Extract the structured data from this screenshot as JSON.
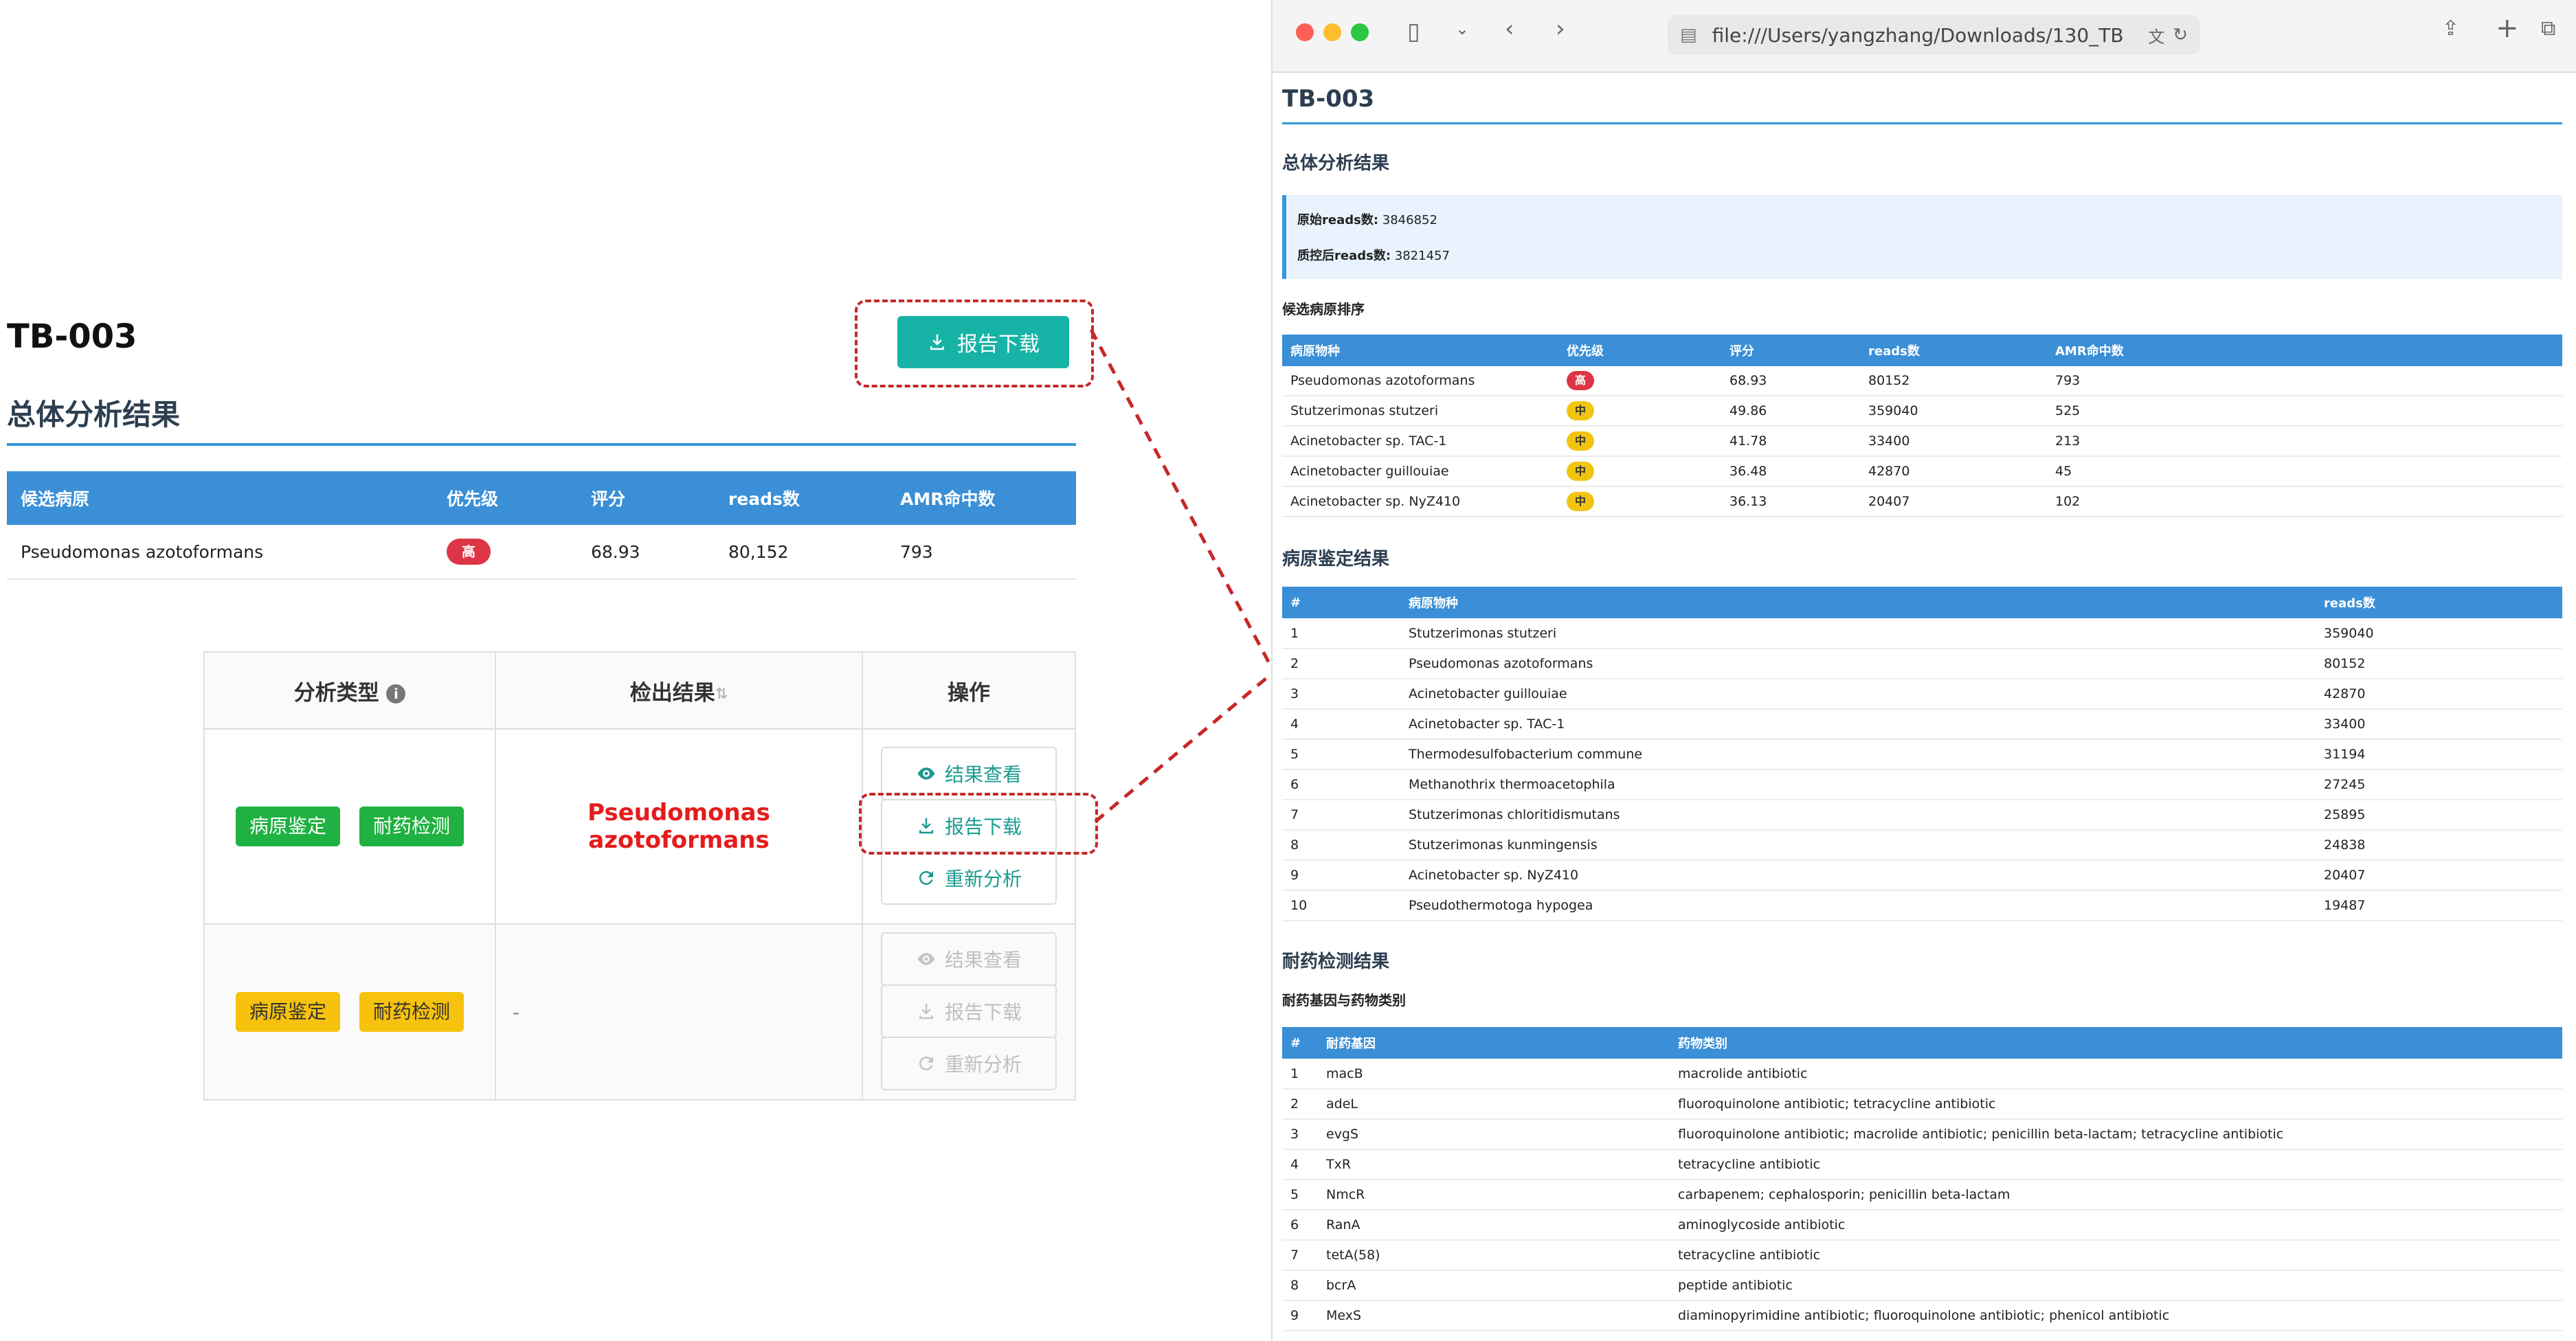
{
  "left": {
    "sample_title": "TB-003",
    "top_download_label": "报告下载",
    "overall_heading": "总体分析结果",
    "candidate_table": {
      "headers": [
        "候选病原",
        "优先级",
        "评分",
        "reads数",
        "AMR命中数"
      ],
      "row": {
        "name": "Pseudomonas azotoformans",
        "priority": "高",
        "score": "68.93",
        "reads": "80,152",
        "amr": "793"
      }
    },
    "analysis_table": {
      "headers": {
        "type": "分析类型",
        "result": "检出结果",
        "ops": "操作"
      },
      "rows": [
        {
          "tags": [
            "病原鉴定",
            "耐药检测"
          ],
          "result": "Pseudomonas azotoformans",
          "disabled": false
        },
        {
          "tags": [
            "病原鉴定",
            "耐药检测"
          ],
          "result": "-",
          "disabled": true
        }
      ],
      "ops": {
        "view": "结果查看",
        "download": "报告下载",
        "reanalyze": "重新分析"
      }
    }
  },
  "browser": {
    "address": "file:///Users/yangzhang/Downloads/130_TB",
    "page_title": "TB-003",
    "overall_heading": "总体分析结果",
    "summary": {
      "raw_reads_label": "原始reads数:",
      "raw_reads_value": "3846852",
      "qc_reads_label": "质控后reads数:",
      "qc_reads_value": "3821457"
    },
    "candidate_heading": "候选病原排序",
    "candidate_table": {
      "headers": [
        "病原物种",
        "优先级",
        "评分",
        "reads数",
        "AMR命中数"
      ],
      "rows": [
        {
          "name": "Pseudomonas azotoformans",
          "priority": "高",
          "level": "high",
          "score": "68.93",
          "reads": "80152",
          "amr": "793"
        },
        {
          "name": "Stutzerimonas stutzeri",
          "priority": "中",
          "level": "mid",
          "score": "49.86",
          "reads": "359040",
          "amr": "525"
        },
        {
          "name": "Acinetobacter sp. TAC-1",
          "priority": "中",
          "level": "mid",
          "score": "41.78",
          "reads": "33400",
          "amr": "213"
        },
        {
          "name": "Acinetobacter guillouiae",
          "priority": "中",
          "level": "mid",
          "score": "36.48",
          "reads": "42870",
          "amr": "45"
        },
        {
          "name": "Acinetobacter sp. NyZ410",
          "priority": "中",
          "level": "mid",
          "score": "36.13",
          "reads": "20407",
          "amr": "102"
        }
      ]
    },
    "pathogen_heading": "病原鉴定结果",
    "pathogen_table": {
      "headers": [
        "#",
        "病原物种",
        "reads数"
      ],
      "rows": [
        {
          "idx": "1",
          "name": "Stutzerimonas stutzeri",
          "reads": "359040"
        },
        {
          "idx": "2",
          "name": "Pseudomonas azotoformans",
          "reads": "80152"
        },
        {
          "idx": "3",
          "name": "Acinetobacter guillouiae",
          "reads": "42870"
        },
        {
          "idx": "4",
          "name": "Acinetobacter sp. TAC-1",
          "reads": "33400"
        },
        {
          "idx": "5",
          "name": "Thermodesulfobacterium commune",
          "reads": "31194"
        },
        {
          "idx": "6",
          "name": "Methanothrix thermoacetophila",
          "reads": "27245"
        },
        {
          "idx": "7",
          "name": "Stutzerimonas chloritidismutans",
          "reads": "25895"
        },
        {
          "idx": "8",
          "name": "Stutzerimonas kunmingensis",
          "reads": "24838"
        },
        {
          "idx": "9",
          "name": "Acinetobacter sp. NyZ410",
          "reads": "20407"
        },
        {
          "idx": "10",
          "name": "Pseudothermotoga hypogea",
          "reads": "19487"
        }
      ]
    },
    "amr_heading": "耐药检测结果",
    "amr_subheading": "耐药基因与药物类别",
    "amr_table": {
      "headers": [
        "#",
        "耐药基因",
        "药物类别"
      ],
      "rows": [
        {
          "idx": "1",
          "gene": "macB",
          "drug": "macrolide antibiotic"
        },
        {
          "idx": "2",
          "gene": "adeL",
          "drug": "fluoroquinolone antibiotic; tetracycline antibiotic"
        },
        {
          "idx": "3",
          "gene": "evgS",
          "drug": "fluoroquinolone antibiotic; macrolide antibiotic; penicillin beta-lactam; tetracycline antibiotic"
        },
        {
          "idx": "4",
          "gene": "TxR",
          "drug": "tetracycline antibiotic"
        },
        {
          "idx": "5",
          "gene": "NmcR",
          "drug": "carbapenem; cephalosporin; penicillin beta-lactam"
        },
        {
          "idx": "6",
          "gene": "RanA",
          "drug": "aminoglycoside antibiotic"
        },
        {
          "idx": "7",
          "gene": "tetA(58)",
          "drug": "tetracycline antibiotic"
        },
        {
          "idx": "8",
          "gene": "bcrA",
          "drug": "peptide antibiotic"
        },
        {
          "idx": "9",
          "gene": "MexS",
          "drug": "diaminopyrimidine antibiotic; fluoroquinolone antibiotic; phenicol antibiotic"
        }
      ]
    }
  },
  "colors": {
    "teal": "#17b3a6",
    "header_blue": "#3a8fd6",
    "rule_blue": "#3498db",
    "badge_high": "#dc3545",
    "badge_mid": "#f1c40f",
    "tag_green": "#1fb141",
    "tag_yellow": "#f7c20d",
    "result_red": "#e41c1c",
    "annotation_red": "#c62828"
  }
}
